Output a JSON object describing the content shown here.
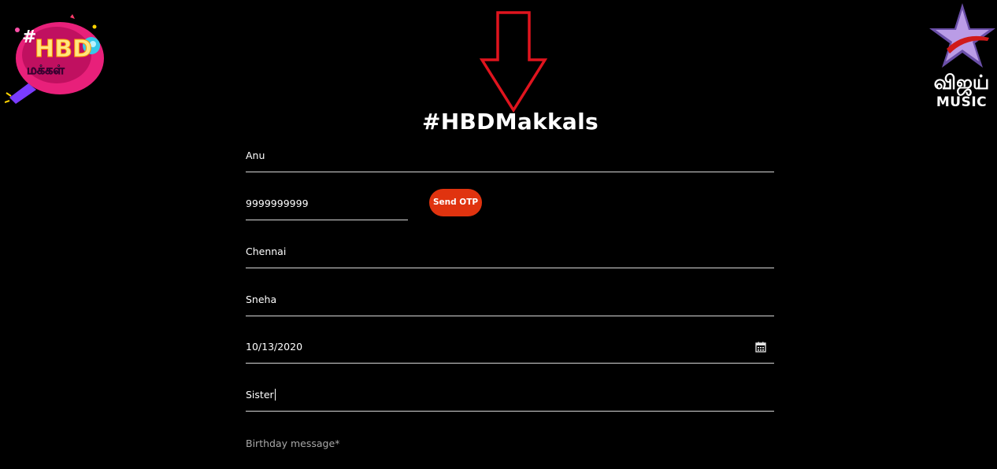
{
  "branding": {
    "left_logo_text_top": "#HBD",
    "left_logo_text_bottom": "மக்கள்",
    "right_logo_tamil": "விஜய்",
    "right_logo_music": "MUSIC"
  },
  "page": {
    "title": "#HBDMakkals"
  },
  "form": {
    "name_value": "Anu",
    "phone_value": "9999999999",
    "send_otp_label": "Send OTP",
    "city_value": "Chennai",
    "friend_name_value": "Sneha",
    "date_value": "10/13/2020",
    "relation_value": "Sister",
    "message_placeholder": "Birthday message*"
  },
  "colors": {
    "background": "#000000",
    "accent_button": "#e0330f",
    "annotation_arrow": "#e0141e",
    "field_underline": "#d7d7d7"
  },
  "icons": {
    "date_picker": "calendar-icon",
    "annotation": "arrow-down-icon"
  }
}
